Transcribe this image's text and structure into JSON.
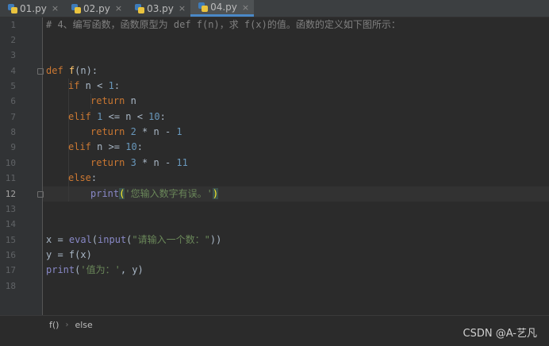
{
  "tabs": [
    {
      "label": "01.py",
      "close": "×"
    },
    {
      "label": "02.py",
      "close": "×"
    },
    {
      "label": "03.py",
      "close": "×"
    },
    {
      "label": "04.py",
      "close": "×"
    }
  ],
  "line_numbers": [
    "1",
    "2",
    "3",
    "4",
    "5",
    "6",
    "7",
    "8",
    "9",
    "10",
    "11",
    "12",
    "13",
    "14",
    "15",
    "16",
    "17",
    "18"
  ],
  "code": {
    "l1_comment": "# 4、编写函数，函数原型为 def f(n)，求 f(x)的值。函数的定义如下图所示：",
    "l4_def": "def",
    "l4_name": "f",
    "l4_rest": "(n):",
    "l5_if": "if",
    "l5_mid": " n < ",
    "l5_num": "1",
    "l5_end": ":",
    "l6_return": "return",
    "l6_rest": " n",
    "l7_elif": "elif",
    "l7_sp": " ",
    "l7_num1": "1",
    "l7_mid": " <= n < ",
    "l7_num2": "10",
    "l7_end": ":",
    "l8_return": "return",
    "l8_sp": " ",
    "l8_num1": "2",
    "l8_mid": " * n - ",
    "l8_num2": "1",
    "l9_elif": "elif",
    "l9_mid": " n >= ",
    "l9_num": "10",
    "l9_end": ":",
    "l10_return": "return",
    "l10_sp": " ",
    "l10_num1": "3",
    "l10_mid": " * n - ",
    "l10_num2": "11",
    "l11_else": "else",
    "l11_end": ":",
    "l12_print": "print",
    "l12_open": "(",
    "l12_str": "'您输入数字有误。'",
    "l12_close": ")",
    "l15_a": "x = ",
    "l15_eval": "eval",
    "l15_b": "(",
    "l15_input": "input",
    "l15_c": "(",
    "l15_str": "\"请输入一个数：\"",
    "l15_d": "))",
    "l16": "y = f(x)",
    "l17_print": "print",
    "l17_a": "(",
    "l17_str": "'值为：'",
    "l17_b": ", y)"
  },
  "breadcrumb": {
    "item1": "f()",
    "sep": "›",
    "item2": "else"
  },
  "watermark": "CSDN @A-艺凡"
}
